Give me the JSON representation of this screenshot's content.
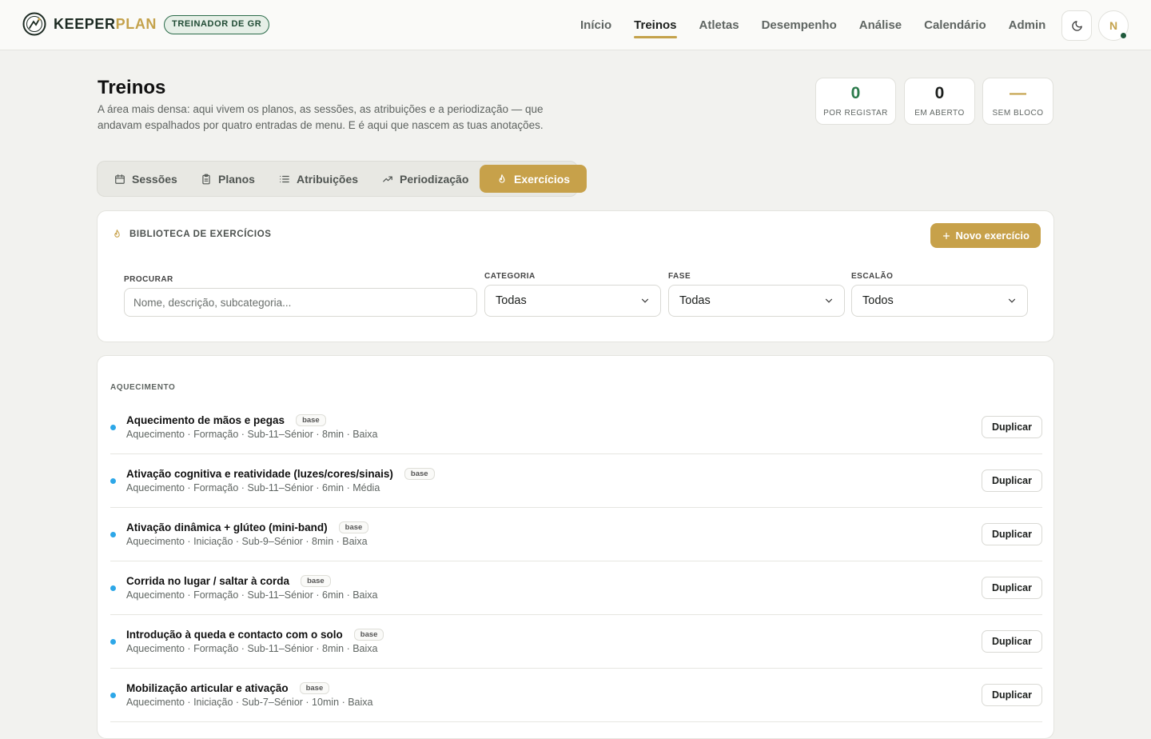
{
  "brand": {
    "name_part1": "KEEPER",
    "name_part2": "PLAN",
    "role_badge": "TREINADOR DE GR"
  },
  "nav": [
    {
      "label": "Início"
    },
    {
      "label": "Treinos",
      "active": true
    },
    {
      "label": "Atletas"
    },
    {
      "label": "Desempenho"
    },
    {
      "label": "Análise"
    },
    {
      "label": "Calendário"
    },
    {
      "label": "Admin"
    }
  ],
  "user": {
    "initial": "N",
    "status": "online"
  },
  "page": {
    "title": "Treinos",
    "description": "A área mais densa: aqui vivem os planos, as sessões, as atribuições e a periodização — que andavam espalhados por quatro entradas de menu. E é aqui que nascem as tuas anotações."
  },
  "stats": [
    {
      "value": "0",
      "label": "POR REGISTAR",
      "color": "#2b7a4b"
    },
    {
      "value": "0",
      "label": "EM ABERTO",
      "color": "#1c1f1d"
    },
    {
      "value": "—",
      "label": "SEM BLOCO",
      "color": "#c4a24b"
    }
  ],
  "tabs": [
    {
      "label": "Sessões",
      "icon": "calendar-icon"
    },
    {
      "label": "Planos",
      "icon": "clipboard-icon"
    },
    {
      "label": "Atribuições",
      "icon": "list-icon"
    },
    {
      "label": "Periodização",
      "icon": "trending-icon"
    },
    {
      "label": "Exercícios",
      "icon": "flame-icon",
      "active": true
    }
  ],
  "library": {
    "title": "BIBLIOTECA DE EXERCÍCIOS",
    "new_button": "Novo exercício",
    "search": {
      "label": "PROCURAR",
      "placeholder": "Nome, descrição, subcategoria..."
    },
    "filters": [
      {
        "label": "CATEGORIA",
        "value": "Todas"
      },
      {
        "label": "FASE",
        "value": "Todas"
      },
      {
        "label": "ESCALÃO",
        "value": "Todos"
      }
    ]
  },
  "list": {
    "group": "AQUECIMENTO",
    "duplicate_label": "Duplicar",
    "items": [
      {
        "name": "Aquecimento de mãos e pegas",
        "tag": "base",
        "meta": "Aquecimento · Formação · Sub-11–Sénior · 8min · Baixa"
      },
      {
        "name": "Ativação cognitiva e reatividade (luzes/cores/sinais)",
        "tag": "base",
        "meta": "Aquecimento · Formação · Sub-11–Sénior · 6min · Média"
      },
      {
        "name": "Ativação dinâmica + glúteo (mini-band)",
        "tag": "base",
        "meta": "Aquecimento · Iniciação · Sub-9–Sénior · 8min · Baixa"
      },
      {
        "name": "Corrida no lugar / saltar à corda",
        "tag": "base",
        "meta": "Aquecimento · Formação · Sub-11–Sénior · 6min · Baixa"
      },
      {
        "name": "Introdução à queda e contacto com o solo",
        "tag": "base",
        "meta": "Aquecimento · Formação · Sub-11–Sénior · 8min · Baixa"
      },
      {
        "name": "Mobilização articular e ativação",
        "tag": "base",
        "meta": "Aquecimento · Iniciação · Sub-7–Sénior · 10min · Baixa"
      }
    ]
  },
  "colors": {
    "accent": "#c7a14a",
    "brand_green": "#1f4a33",
    "dot": "#2da7e8"
  }
}
